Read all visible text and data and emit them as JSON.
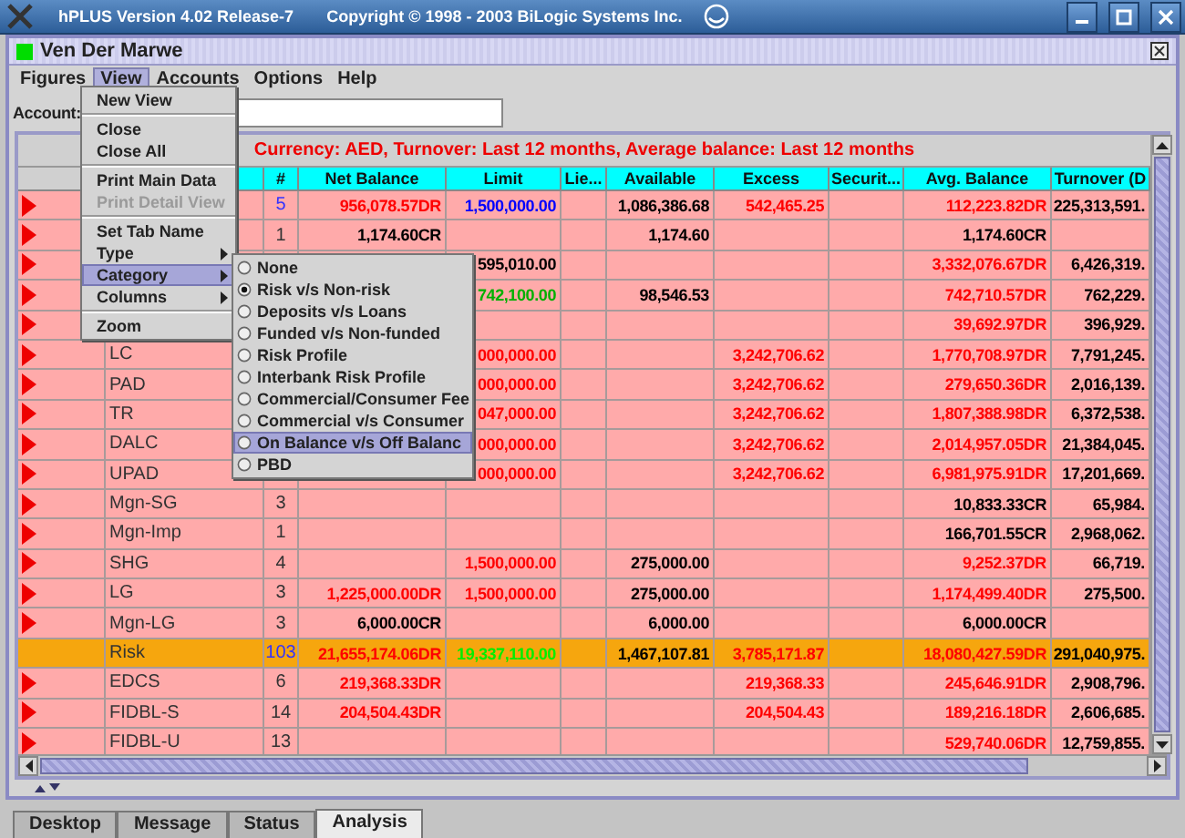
{
  "app_title": "hPLUS Version 4.02 Release-7",
  "copyright": "Copyright © 1998 - 2003 BiLogic Systems Inc.",
  "window": {
    "title": "Ven Der Marwe"
  },
  "menu_bar": [
    {
      "label": "Figures",
      "selected": false
    },
    {
      "label": "View",
      "selected": true
    },
    {
      "label": "Accounts",
      "selected": false
    },
    {
      "label": "Options",
      "selected": false
    },
    {
      "label": "Help",
      "selected": false
    }
  ],
  "view_menu": [
    {
      "kind": "item",
      "label": "New View",
      "disabled": false,
      "selected": false
    },
    {
      "kind": "separator"
    },
    {
      "kind": "item",
      "label": "Close",
      "disabled": false,
      "selected": false
    },
    {
      "kind": "item",
      "label": "Close All",
      "disabled": false,
      "selected": false
    },
    {
      "kind": "separator"
    },
    {
      "kind": "item",
      "label": "Print Main Data",
      "disabled": false,
      "selected": false
    },
    {
      "kind": "item",
      "label": "Print Detail View",
      "disabled": true,
      "selected": false
    },
    {
      "kind": "separator"
    },
    {
      "kind": "item",
      "label": "Set Tab Name",
      "disabled": false,
      "selected": false
    },
    {
      "kind": "submenu",
      "label": "Type",
      "disabled": false,
      "selected": false
    },
    {
      "kind": "submenu",
      "label": "Category",
      "disabled": false,
      "selected": true
    },
    {
      "kind": "submenu",
      "label": "Columns",
      "disabled": false,
      "selected": false
    },
    {
      "kind": "separator"
    },
    {
      "kind": "item",
      "label": "Zoom",
      "disabled": false,
      "selected": false
    }
  ],
  "category_menu": [
    {
      "label": "None",
      "checked": false,
      "selected": false
    },
    {
      "label": "Risk v/s Non-risk",
      "checked": true,
      "selected": false
    },
    {
      "label": "Deposits v/s Loans",
      "checked": false,
      "selected": false
    },
    {
      "label": "Funded v/s Non-funded",
      "checked": false,
      "selected": false
    },
    {
      "label": "Risk Profile",
      "checked": false,
      "selected": false
    },
    {
      "label": "Interbank Risk Profile",
      "checked": false,
      "selected": false
    },
    {
      "label": "Commercial/Consumer Fee",
      "checked": false,
      "selected": false
    },
    {
      "label": "Commercial v/s Consumer",
      "checked": false,
      "selected": false
    },
    {
      "label": "On Balance v/s Off Balanc",
      "checked": false,
      "selected": true
    },
    {
      "label": "PBD",
      "checked": false,
      "selected": false
    }
  ],
  "account": {
    "label": "Account:"
  },
  "summary": "Currency: AED,  Turnover: Last 12 months,  Average balance: Last 12 months",
  "table": {
    "columns": [
      "#",
      "Net Balance",
      "Limit",
      "Lie...",
      "Available",
      "Excess",
      "Securit...",
      "Avg. Balance",
      "Turnover (D"
    ],
    "rows": [
      {
        "marker": true,
        "selected": false,
        "cells": {
          "count": {
            "text": "5",
            "color": "#3333ff"
          },
          "net_balance": {
            "text": "956,078.57DR",
            "color": "#ff0000"
          },
          "limit": {
            "text": "1,500,000.00",
            "color": "#0000ff"
          },
          "available": {
            "text": "1,086,386.68",
            "color": "#000000"
          },
          "excess": {
            "text": "542,465.25",
            "color": "#ff0000"
          },
          "avg_balance": {
            "text": "112,223.82DR",
            "color": "#ff0000"
          },
          "turnover": {
            "text": "225,313,591.",
            "color": "#000000"
          }
        }
      },
      {
        "marker": true,
        "selected": false,
        "cells": {
          "count": {
            "text": "1",
            "color": "#333333"
          },
          "net_balance": {
            "text": "1,174.60CR",
            "color": "#000000"
          },
          "available": {
            "text": "1,174.60",
            "color": "#000000"
          },
          "avg_balance": {
            "text": "1,174.60CR",
            "color": "#000000"
          }
        }
      },
      {
        "marker": true,
        "selected": false,
        "cells": {
          "limit": {
            "text": "595,010.00",
            "color": "#000000"
          },
          "avg_balance": {
            "text": "3,332,076.67DR",
            "color": "#ff0000"
          },
          "turnover": {
            "text": "6,426,319.",
            "color": "#000000"
          }
        }
      },
      {
        "marker": true,
        "selected": false,
        "cells": {
          "limit": {
            "text": "742,100.00",
            "color": "#00b000"
          },
          "available": {
            "text": "98,546.53",
            "color": "#000000"
          },
          "avg_balance": {
            "text": "742,710.57DR",
            "color": "#ff0000"
          },
          "turnover": {
            "text": "762,229.",
            "color": "#000000"
          }
        }
      },
      {
        "marker": true,
        "selected": false,
        "cells": {
          "avg_balance": {
            "text": "39,692.97DR",
            "color": "#ff0000"
          },
          "turnover": {
            "text": "396,929.",
            "color": "#000000"
          }
        }
      },
      {
        "marker": true,
        "selected": false,
        "cells": {
          "name": {
            "text": "LC",
            "color": "#333333"
          },
          "limit": {
            "text": "000,000.00",
            "color": "#ff0000"
          },
          "excess": {
            "text": "3,242,706.62",
            "color": "#ff0000"
          },
          "avg_balance": {
            "text": "1,770,708.97DR",
            "color": "#ff0000"
          },
          "turnover": {
            "text": "7,791,245.",
            "color": "#000000"
          }
        }
      },
      {
        "marker": true,
        "selected": false,
        "cells": {
          "name": {
            "text": "PAD",
            "color": "#333333"
          },
          "limit": {
            "text": "000,000.00",
            "color": "#ff0000"
          },
          "excess": {
            "text": "3,242,706.62",
            "color": "#ff0000"
          },
          "avg_balance": {
            "text": "279,650.36DR",
            "color": "#ff0000"
          },
          "turnover": {
            "text": "2,016,139.",
            "color": "#000000"
          }
        }
      },
      {
        "marker": true,
        "selected": false,
        "cells": {
          "name": {
            "text": "TR",
            "color": "#333333"
          },
          "limit": {
            "text": "047,000.00",
            "color": "#ff0000"
          },
          "excess": {
            "text": "3,242,706.62",
            "color": "#ff0000"
          },
          "avg_balance": {
            "text": "1,807,388.98DR",
            "color": "#ff0000"
          },
          "turnover": {
            "text": "6,372,538.",
            "color": "#000000"
          }
        }
      },
      {
        "marker": true,
        "selected": false,
        "cells": {
          "name": {
            "text": "DALC",
            "color": "#333333"
          },
          "limit": {
            "text": "000,000.00",
            "color": "#ff0000"
          },
          "excess": {
            "text": "3,242,706.62",
            "color": "#ff0000"
          },
          "avg_balance": {
            "text": "2,014,957.05DR",
            "color": "#ff0000"
          },
          "turnover": {
            "text": "21,384,045.",
            "color": "#000000"
          }
        }
      },
      {
        "marker": true,
        "selected": false,
        "cells": {
          "name": {
            "text": "UPAD",
            "color": "#333333"
          },
          "limit": {
            "text": "000,000.00",
            "color": "#ff0000"
          },
          "excess": {
            "text": "3,242,706.62",
            "color": "#ff0000"
          },
          "avg_balance": {
            "text": "6,981,975.91DR",
            "color": "#ff0000"
          },
          "turnover": {
            "text": "17,201,669.",
            "color": "#000000"
          }
        }
      },
      {
        "marker": true,
        "selected": false,
        "cells": {
          "name": {
            "text": "Mgn-SG",
            "color": "#333333"
          },
          "count": {
            "text": "3",
            "color": "#333333"
          },
          "avg_balance": {
            "text": "10,833.33CR",
            "color": "#000000"
          },
          "turnover": {
            "text": "65,984.",
            "color": "#000000"
          }
        }
      },
      {
        "marker": true,
        "selected": false,
        "cells": {
          "name": {
            "text": "Mgn-Imp",
            "color": "#333333"
          },
          "count": {
            "text": "1",
            "color": "#333333"
          },
          "avg_balance": {
            "text": "166,701.55CR",
            "color": "#000000"
          },
          "turnover": {
            "text": "2,968,062.",
            "color": "#000000"
          }
        }
      },
      {
        "marker": true,
        "selected": false,
        "cells": {
          "name": {
            "text": "SHG",
            "color": "#333333"
          },
          "count": {
            "text": "4",
            "color": "#333333"
          },
          "limit": {
            "text": "1,500,000.00",
            "color": "#ff0000"
          },
          "available": {
            "text": "275,000.00",
            "color": "#000000"
          },
          "avg_balance": {
            "text": "9,252.37DR",
            "color": "#ff0000"
          },
          "turnover": {
            "text": "66,719.",
            "color": "#000000"
          }
        }
      },
      {
        "marker": true,
        "selected": false,
        "cells": {
          "name": {
            "text": "LG",
            "color": "#333333"
          },
          "count": {
            "text": "3",
            "color": "#333333"
          },
          "net_balance": {
            "text": "1,225,000.00DR",
            "color": "#ff0000"
          },
          "limit": {
            "text": "1,500,000.00",
            "color": "#ff0000"
          },
          "available": {
            "text": "275,000.00",
            "color": "#000000"
          },
          "avg_balance": {
            "text": "1,174,499.40DR",
            "color": "#ff0000"
          },
          "turnover": {
            "text": "275,500.",
            "color": "#000000"
          }
        }
      },
      {
        "marker": true,
        "selected": false,
        "cells": {
          "name": {
            "text": "Mgn-LG",
            "color": "#333333"
          },
          "count": {
            "text": "3",
            "color": "#333333"
          },
          "net_balance": {
            "text": "6,000.00CR",
            "color": "#000000"
          },
          "available": {
            "text": "6,000.00",
            "color": "#000000"
          },
          "avg_balance": {
            "text": "6,000.00CR",
            "color": "#000000"
          }
        }
      },
      {
        "marker": false,
        "selected": true,
        "cells": {
          "name": {
            "text": "Risk",
            "color": "#333333"
          },
          "count": {
            "text": "103",
            "color": "#3333ff"
          },
          "net_balance": {
            "text": "21,655,174.06DR",
            "color": "#ff0000"
          },
          "limit": {
            "text": "19,337,110.00",
            "color": "#00ee00"
          },
          "available": {
            "text": "1,467,107.81",
            "color": "#000000"
          },
          "excess": {
            "text": "3,785,171.87",
            "color": "#ff0000"
          },
          "avg_balance": {
            "text": "18,080,427.59DR",
            "color": "#ff0000"
          },
          "turnover": {
            "text": "291,040,975.",
            "color": "#000000"
          }
        }
      },
      {
        "marker": true,
        "selected": false,
        "cells": {
          "name": {
            "text": "EDCS",
            "color": "#333333"
          },
          "count": {
            "text": "6",
            "color": "#333333"
          },
          "net_balance": {
            "text": "219,368.33DR",
            "color": "#ff0000"
          },
          "excess": {
            "text": "219,368.33",
            "color": "#ff0000"
          },
          "avg_balance": {
            "text": "245,646.91DR",
            "color": "#ff0000"
          },
          "turnover": {
            "text": "2,908,796.",
            "color": "#000000"
          }
        }
      },
      {
        "marker": true,
        "selected": false,
        "cells": {
          "name": {
            "text": "FIDBL-S",
            "color": "#333333"
          },
          "count": {
            "text": "14",
            "color": "#333333"
          },
          "net_balance": {
            "text": "204,504.43DR",
            "color": "#ff0000"
          },
          "excess": {
            "text": "204,504.43",
            "color": "#ff0000"
          },
          "avg_balance": {
            "text": "189,216.18DR",
            "color": "#ff0000"
          },
          "turnover": {
            "text": "2,606,685.",
            "color": "#000000"
          }
        }
      },
      {
        "marker": true,
        "selected": false,
        "cells": {
          "name": {
            "text": "FIDBL-U",
            "color": "#333333"
          },
          "count": {
            "text": "13",
            "color": "#333333"
          },
          "avg_balance": {
            "text": "529,740.06DR",
            "color": "#ff0000"
          },
          "turnover": {
            "text": "12,759,855.",
            "color": "#000000"
          }
        }
      }
    ]
  },
  "bottom_tabs": [
    {
      "label": "Desktop",
      "selected": false
    },
    {
      "label": "Message",
      "selected": false
    },
    {
      "label": "Status",
      "selected": false
    },
    {
      "label": "Analysis",
      "selected": true
    }
  ]
}
